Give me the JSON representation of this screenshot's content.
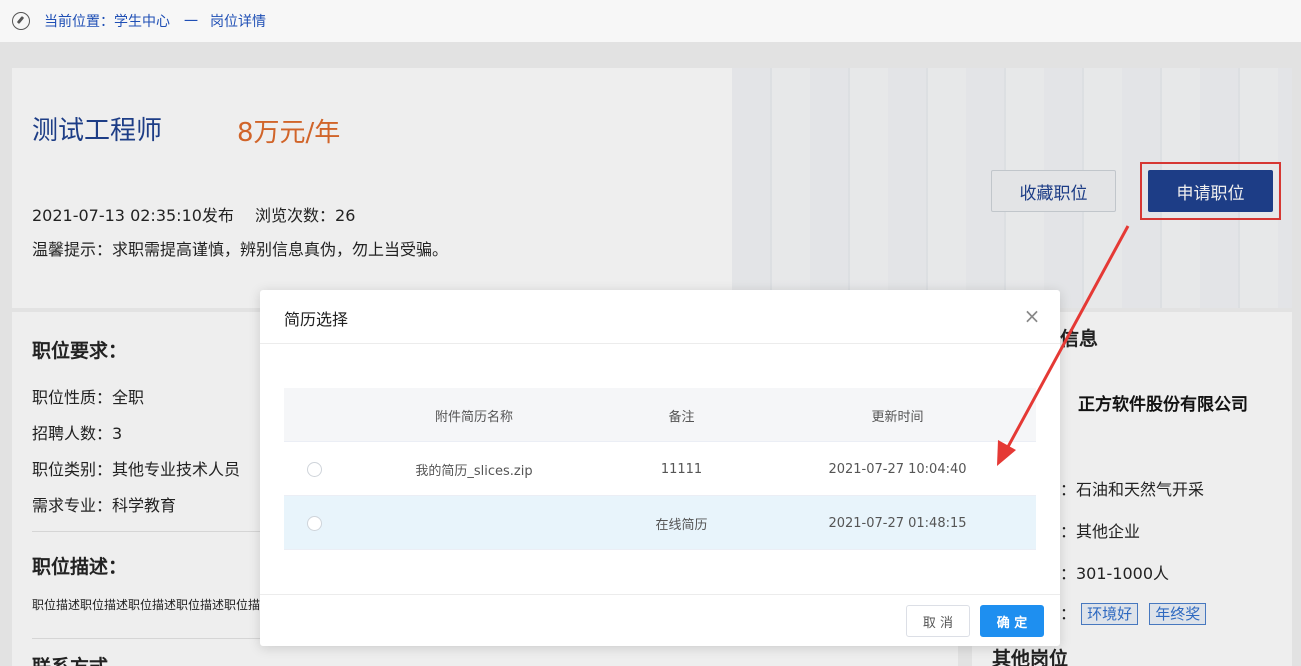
{
  "breadcrumb": {
    "prefix": "当前位置：学生中心",
    "separator": "一",
    "current": "岗位详情"
  },
  "job": {
    "title": "测试工程师",
    "salary": "8万元/年",
    "published": "2021-07-13 02:35:10发布",
    "views": "浏览次数：26",
    "tip": "温馨提示：求职需提高谨慎，辨别信息真伪，勿上当受骗。",
    "favorite_button": "收藏职位",
    "apply_button": "申请职位"
  },
  "requirements": {
    "title": "职位要求：",
    "nature": "职位性质：全职",
    "count": "招聘人数：3",
    "category": "职位类别：其他专业技术人员",
    "major": "需求专业：科学教育",
    "desc_title": "职位描述：",
    "desc_text": "职位描述职位描述职位描述职位描述职位描述职位描述",
    "contact_title": "联系方式"
  },
  "company": {
    "title_fragment": "信息",
    "name": "正方软件股份有限公司",
    "industry": "：石油和天然气开采",
    "type": "：其他企业",
    "size": "：301-1000人",
    "tags_prefix": "：",
    "tags": [
      "环境好",
      "年终奖"
    ],
    "other_title": "其他岗位"
  },
  "dialog": {
    "title": "简历选择",
    "close": "×",
    "columns": [
      "附件简历名称",
      "备注",
      "更新时间"
    ],
    "rows": [
      {
        "name": "我的简历_slices.zip",
        "note": "11111",
        "time": "2021-07-27 10:04:40"
      },
      {
        "name": "",
        "note": "在线简历",
        "time": "2021-07-27 01:48:15"
      }
    ],
    "cancel_button": "取 消",
    "ok_button": "确 定"
  },
  "colors": {
    "primary": "#1d3f8f",
    "salary": "#e06a2a",
    "ok": "#1e8ff0",
    "annotation": "#e53935"
  }
}
